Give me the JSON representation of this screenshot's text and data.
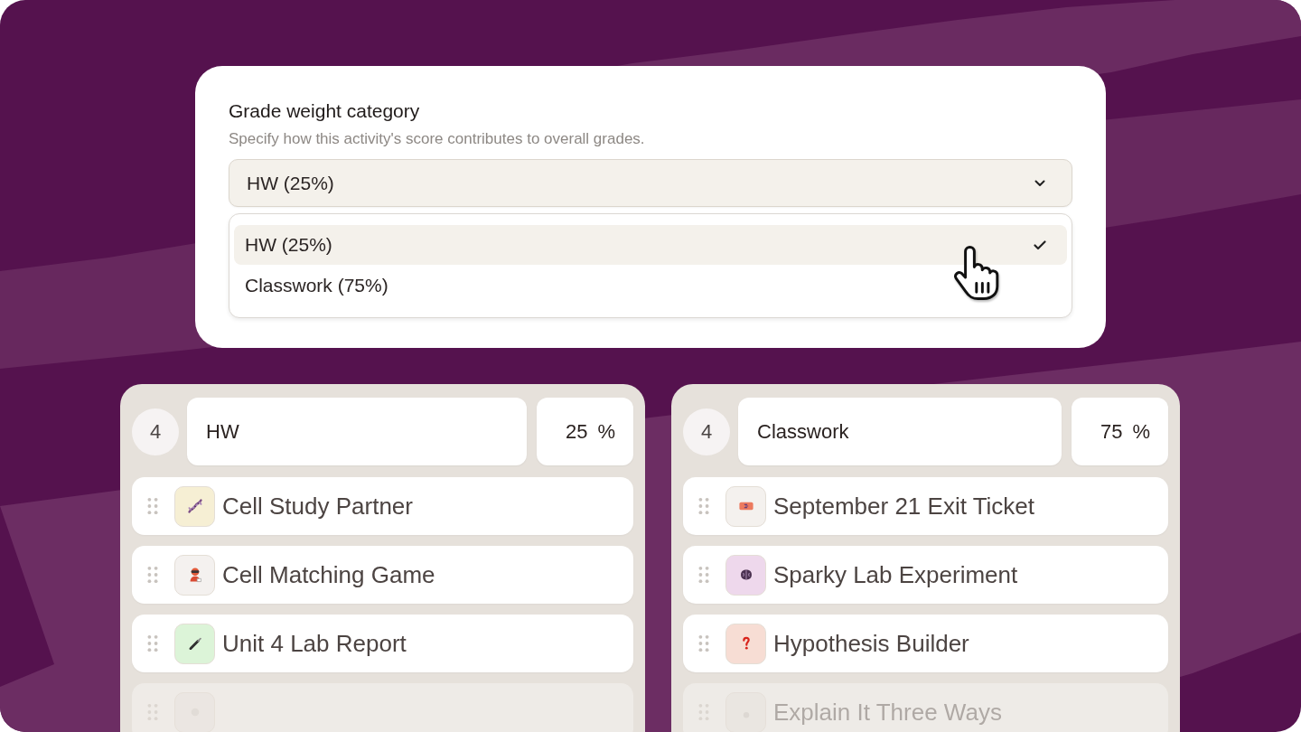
{
  "grade_weight": {
    "title": "Grade weight category",
    "description": "Specify how this activity's score contributes to overall grades.",
    "select": {
      "value": "HW (25%)",
      "expanded": true
    },
    "options": [
      {
        "label": "HW (25%)",
        "selected": true
      },
      {
        "label": "Classwork (75%)",
        "selected": false
      }
    ]
  },
  "categories": [
    {
      "count": "4",
      "name": "HW",
      "percent": "25",
      "unit": "%",
      "items": [
        {
          "title": "Cell Study Partner",
          "color": "#f6efd4"
        },
        {
          "title": "Cell Matching Game",
          "color": "#f4f1ef"
        },
        {
          "title": "Unit 4 Lab Report",
          "color": "#dcf4d8"
        },
        {
          "color": "#f4f1ef"
        }
      ]
    },
    {
      "count": "4",
      "name": "Classwork",
      "percent": "75",
      "unit": "%",
      "items": [
        {
          "title": "September 21 Exit Ticket",
          "color": "#f4f1ee"
        },
        {
          "title": "Sparky Lab Experiment",
          "color": "#eed8ec"
        },
        {
          "title": "Hypothesis Builder",
          "color": "#f7ddd4"
        },
        {
          "title": "Explain It Three Ways",
          "color": "#f4f1ee"
        }
      ]
    }
  ]
}
